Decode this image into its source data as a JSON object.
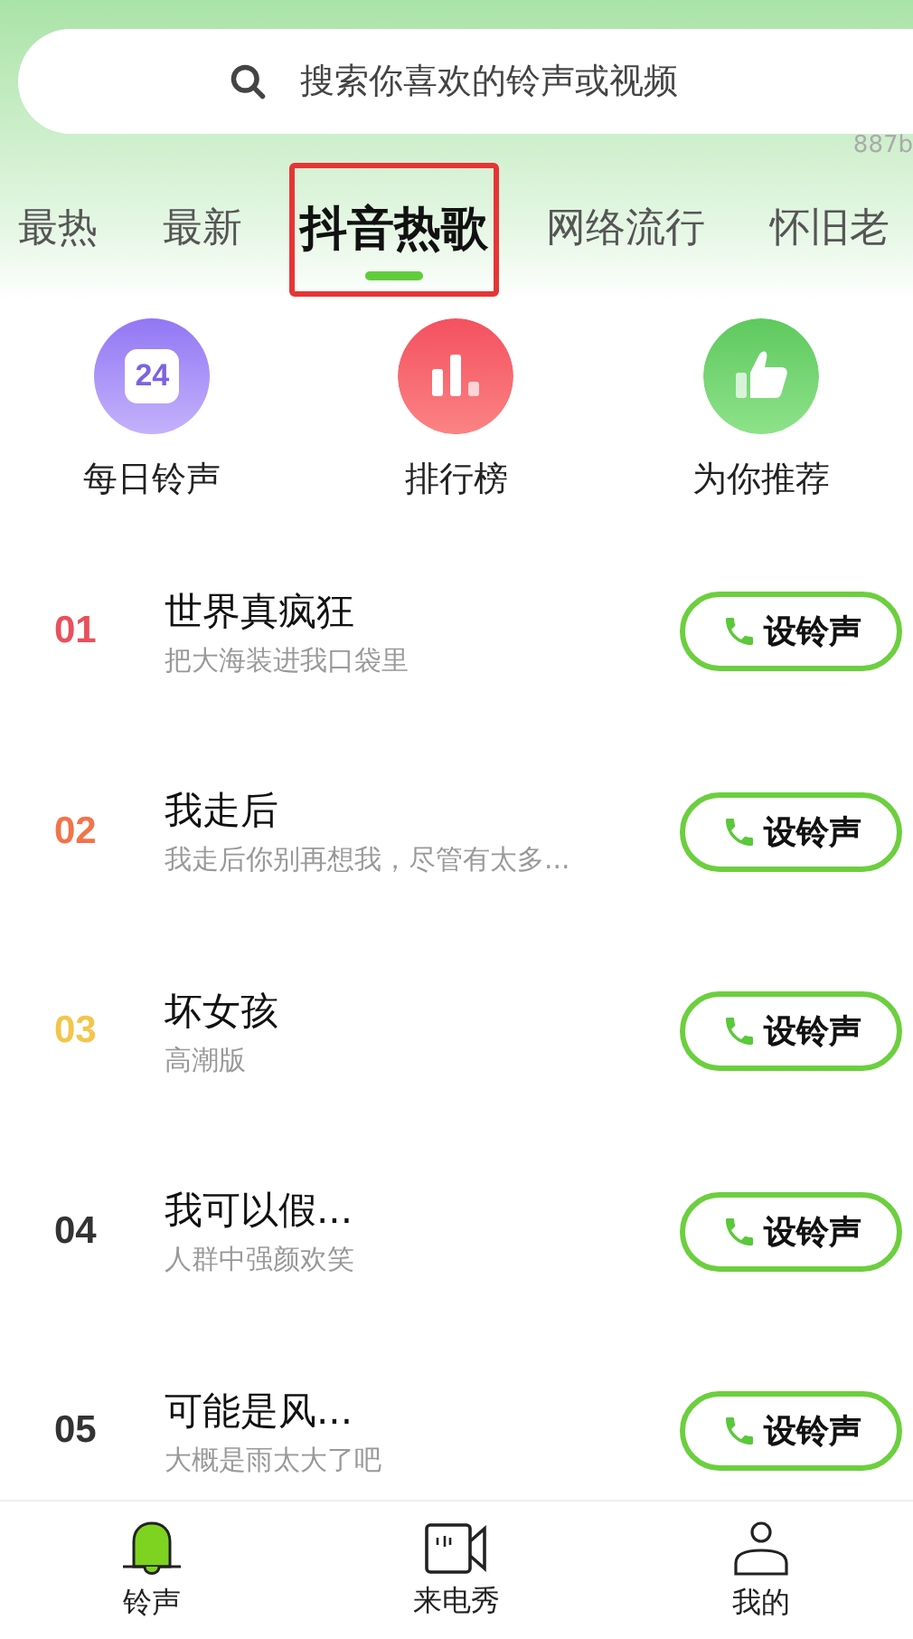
{
  "search": {
    "placeholder": "搜索你喜欢的铃声或视频"
  },
  "corner_text": "887b",
  "tabs": [
    {
      "label": "最热",
      "selected": false
    },
    {
      "label": "最新",
      "selected": false
    },
    {
      "label": "抖音热歌",
      "selected": true
    },
    {
      "label": "网络流行",
      "selected": false
    },
    {
      "label": "怀旧老",
      "selected": false
    }
  ],
  "shortcuts": [
    {
      "kind": "calendar",
      "label": "每日铃声",
      "icon_text": "24"
    },
    {
      "kind": "chart",
      "label": "排行榜"
    },
    {
      "kind": "like",
      "label": "为你推荐"
    }
  ],
  "songs": [
    {
      "rank": "01",
      "color": "#e9505c",
      "title": "世界真疯狂",
      "subtitle": "把大海装进我口袋里",
      "button": "设铃声"
    },
    {
      "rank": "02",
      "color": "#f2734a",
      "title": "我走后",
      "subtitle": "我走后你别再想我，尽管有太多...",
      "button": "设铃声"
    },
    {
      "rank": "03",
      "color": "#f4c54b",
      "title": "坏女孩",
      "subtitle": "高潮版",
      "button": "设铃声"
    },
    {
      "rank": "04",
      "color": "#333333",
      "title": "我可以假...",
      "subtitle": "人群中强颜欢笑",
      "button": "设铃声"
    },
    {
      "rank": "05",
      "color": "#333333",
      "title": "可能是风...",
      "subtitle": "大概是雨太大了吧",
      "button": "设铃声"
    }
  ],
  "nav": [
    {
      "kind": "bell",
      "label": "铃声",
      "selected": true
    },
    {
      "kind": "video",
      "label": "来电秀",
      "selected": false
    },
    {
      "kind": "user",
      "label": "我的",
      "selected": false
    }
  ]
}
